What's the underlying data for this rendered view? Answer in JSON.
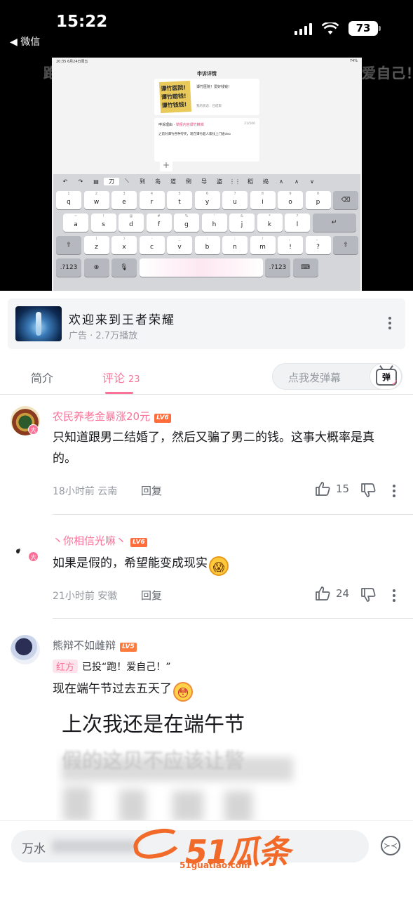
{
  "status_bar": {
    "time": "15:22",
    "back_app": "◀ 微信",
    "battery": "73"
  },
  "video": {
    "watermark": "跑！爱自己！",
    "screen": {
      "status_left": "20:35  6月24日周五",
      "status_right": "74%",
      "page_title": "申诉详情",
      "sticker_lines": [
        "谭竹医院!",
        "谭竹赔钱!",
        "谭竹钱钱!"
      ],
      "card_text": "谭竹医院！爱好钱钱！",
      "card_status": "我的状态：已结束",
      "reason_label": "申诉理由",
      "reason_tag": "举报内容谭竹精准",
      "reason_count": "21/500",
      "reason_text": "之前对谭竹各种夸奖，现在谭竹超人家找上门姐deo",
      "plus": "+"
    },
    "keyboard": {
      "toolbar": [
        "↶",
        "↷",
        "▤",
        "刀",
        "⟍",
        "到",
        "岛",
        "道",
        "倒",
        "导",
        "盗",
        "⋮⋮",
        "稻",
        "捣",
        "∧",
        "∧",
        "∨"
      ],
      "toolbar_selected_index": 3,
      "row1": [
        [
          "q",
          "1"
        ],
        [
          "w",
          "2"
        ],
        [
          "e",
          "3"
        ],
        [
          "r",
          "4"
        ],
        [
          "t",
          "5"
        ],
        [
          "y",
          "6"
        ],
        [
          "u",
          "7"
        ],
        [
          "i",
          "8"
        ],
        [
          "o",
          "9"
        ],
        [
          "p",
          "0"
        ],
        [
          "⌫",
          ""
        ]
      ],
      "row2": [
        [
          "a",
          "~"
        ],
        [
          "s",
          "!"
        ],
        [
          "d",
          "@"
        ],
        [
          "f",
          "#"
        ],
        [
          "g",
          "%"
        ],
        [
          "h",
          "'"
        ],
        [
          "j",
          "&"
        ],
        [
          "k",
          "*"
        ],
        [
          "l",
          "?"
        ],
        [
          "↵",
          ""
        ]
      ],
      "row3": [
        [
          "⇧",
          ""
        ],
        [
          "z",
          "("
        ],
        [
          "x",
          ")"
        ],
        [
          "c",
          "-"
        ],
        [
          "v",
          "_"
        ],
        [
          "b",
          ":"
        ],
        [
          "n",
          ";"
        ],
        [
          "m",
          "/"
        ],
        [
          "!",
          "，"
        ],
        [
          "?",
          "。"
        ],
        [
          "⇧",
          ""
        ]
      ],
      "row4": [
        ".?123",
        "⊕",
        "🎙",
        "",
        ".?123",
        "⌨"
      ]
    }
  },
  "ad": {
    "title": "欢迎来到王者荣耀",
    "subtitle": "广告 · 2.7万播放"
  },
  "tabs": {
    "intro": "简介",
    "comments": "评论",
    "comment_count": "23",
    "danmu_placeholder": "点我发弹幕",
    "danmu_icon": "弹"
  },
  "comments": [
    {
      "user": "农民养老金暴涨20元",
      "level": "LV6",
      "badge": "大",
      "text": "只知道跟男二结婚了，然后又骗了男二的钱。这事大概率是真的。",
      "time": "18小时前",
      "location": "云南",
      "reply": "回复",
      "likes": "15"
    },
    {
      "user": "丶你相信光嘛丶",
      "level": "LV6",
      "badge": "大",
      "text": "如果是假的，希望能变成现实",
      "emoji": "😱",
      "time": "21小时前",
      "location": "安徽",
      "reply": "回复",
      "likes": "24"
    },
    {
      "user": "熊辩不如雌辩",
      "level": "LV5",
      "vote_tag": "红方",
      "vote_text": "已投“跑！爱自己！”",
      "text": "现在端午节过去五天了",
      "emoji": "😳",
      "big_lines": [
        "上次我还是在端午节",
        "假的这贝不应该让警"
      ]
    }
  ],
  "bottom": {
    "input_placeholder": "万水",
    "emoji_btn": "≻≺",
    "logo_word": "51瓜条",
    "logo_url": "51guatiao.com"
  }
}
